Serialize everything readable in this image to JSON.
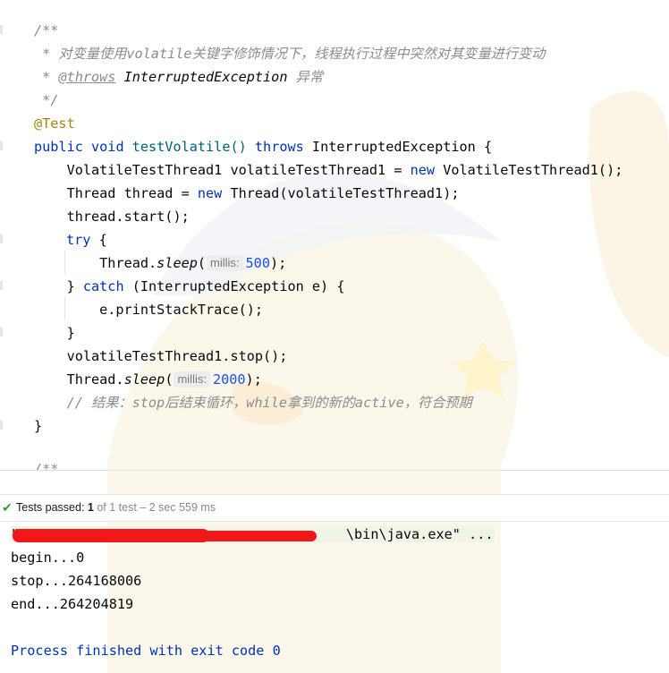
{
  "editor": {
    "line1": "/**",
    "line2": " * 对变量使用volatile关键字修饰情况下，线程执行过程中突然对其变量进行变动",
    "line3_prefix": " * ",
    "line3_tag": "@throws",
    "line3_type": " InterruptedException",
    "line3_desc": " 异常",
    "line4": " */",
    "line5": "@Test",
    "line6_kw1": "public",
    "line6_kw2": " void",
    "line6_name": " testVolatile() ",
    "line6_kw3": "throws",
    "line6_rest": " InterruptedException {",
    "line7_a": "    VolatileTestThread1 volatileTestThread1 = ",
    "line7_kw": "new",
    "line7_b": " VolatileTestThread1();",
    "line8_a": "    Thread thread = ",
    "line8_kw": "new",
    "line8_b": " Thread(volatileTestThread1);",
    "line9": "    thread.start();",
    "line10_kw": "try",
    "line10_b": " {",
    "line11_a": "        Thread.",
    "line11_sleep": "sleep",
    "line11_b": "(",
    "line11_hint": "millis:",
    "line11_num": "500",
    "line11_c": ");",
    "line12_a": "    } ",
    "line12_kw": "catch",
    "line12_b": " (InterruptedException e) {",
    "line13": "        e.printStackTrace();",
    "line14": "    }",
    "line15": "    volatileTestThread1.stop();",
    "line16_a": "    Thread.",
    "line16_sleep": "sleep",
    "line16_b": "(",
    "line16_hint": "millis:",
    "line16_num": "2000",
    "line16_c": ");",
    "line17": "    // 结果：stop后结束循环，while拿到的新的active，符合预期",
    "line18": "}",
    "line19": "/**"
  },
  "test_status": {
    "label": "Tests passed:",
    "passed": "1",
    "rest": "of 1 test – 2 sec 559 ms"
  },
  "console": {
    "command": "\"                                        \\bin\\java.exe\" ...",
    "out1": "begin...0",
    "out2": "stop...264168006",
    "out3": "end...264204819",
    "exit": "Process finished with exit code 0"
  },
  "colors": {
    "keyword": "#0033b3",
    "comment": "#8c8c8c",
    "annotation": "#9e880d",
    "number": "#1750eb",
    "passed_check": "#3a9a3a",
    "redaction": "#f01818"
  }
}
